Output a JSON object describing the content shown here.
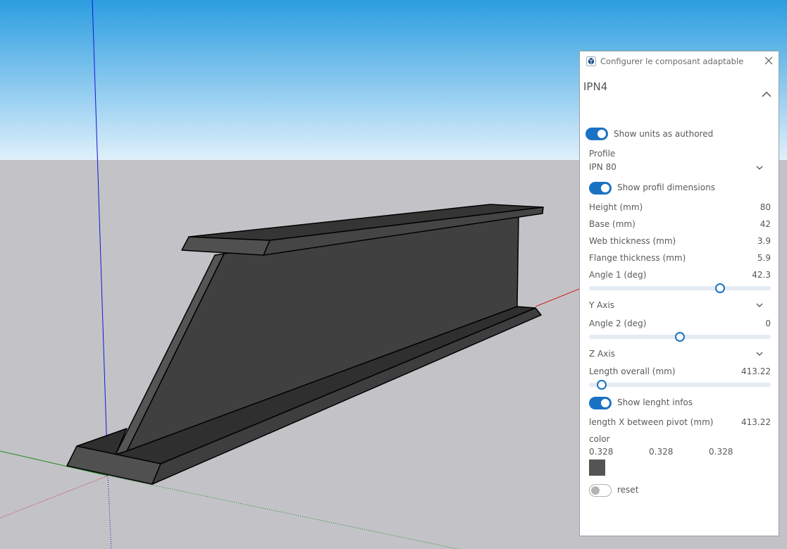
{
  "colors": {
    "sky_top": "#2b9de0",
    "sky_bottom": "#dff0fb",
    "ground": "#c3c3c7",
    "beam_dark": "#323232",
    "beam_mid": "#404040",
    "beam_light": "#555555",
    "accent": "#1a72c4",
    "swatch": "#545454"
  },
  "panel": {
    "title": "Configurer le composant adaptable",
    "component_name": "IPN4",
    "show_units": {
      "label": "Show units as authored",
      "on": true
    },
    "profile": {
      "label": "Profile",
      "value": "IPN 80"
    },
    "show_profil": {
      "label": "Show profil dimensions",
      "on": true
    },
    "dimensions": [
      {
        "label": "Height (mm)",
        "value": "80"
      },
      {
        "label": "Base (mm)",
        "value": "42"
      },
      {
        "label": "Web thickness (mm)",
        "value": "3.9"
      },
      {
        "label": "Flange thickness (mm)",
        "value": "5.9"
      }
    ],
    "angle1": {
      "label": "Angle 1 (deg)",
      "value": "42.3",
      "slider_fraction": 0.72
    },
    "y_axis": {
      "label": "Y Axis"
    },
    "angle2": {
      "label": "Angle 2 (deg)",
      "value": "0",
      "slider_fraction": 0.5
    },
    "z_axis": {
      "label": "Z Axis"
    },
    "length_overall": {
      "label": "Length overall (mm)",
      "value": "413.22",
      "slider_fraction": 0.07
    },
    "show_length": {
      "label": "Show lenght infos",
      "on": true
    },
    "length_x": {
      "label": "length X between pivot (mm)",
      "value": "413.22"
    },
    "color": {
      "label": "color",
      "r": "0.328",
      "g": "0.328",
      "b": "0.328"
    },
    "reset": {
      "label": "reset",
      "on": false
    }
  }
}
